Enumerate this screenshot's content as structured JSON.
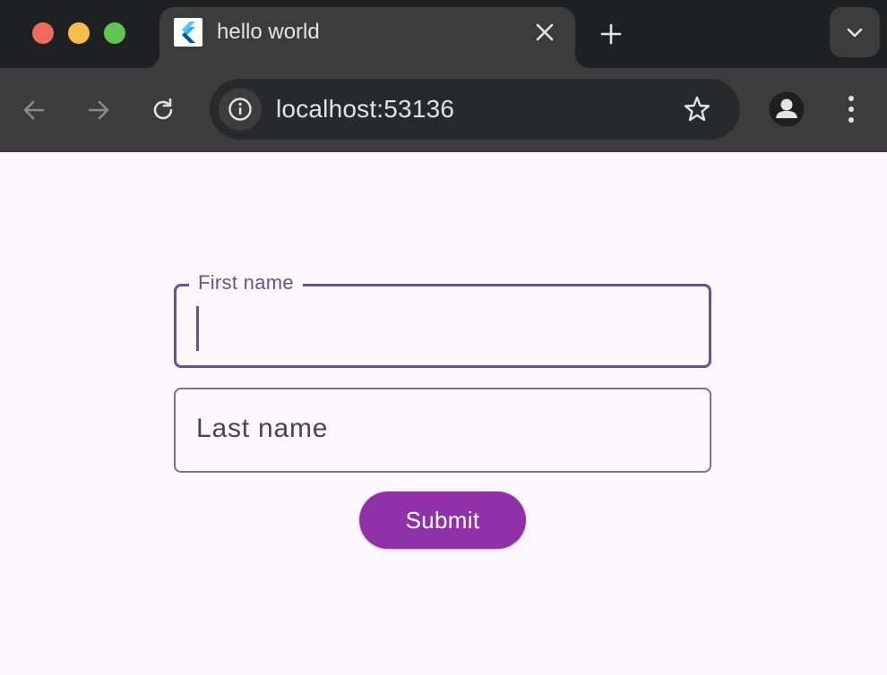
{
  "window": {
    "traffic_lights": [
      "close",
      "minimize",
      "maximize"
    ]
  },
  "tab": {
    "title": "hello world",
    "favicon": "flutter-logo-icon"
  },
  "toolbar": {
    "url": "localhost:53136"
  },
  "form": {
    "first_name_label": "First name",
    "first_name_value": "",
    "last_name_label": "Last name",
    "last_name_value": "",
    "submit_label": "Submit"
  },
  "colors": {
    "focused_outline": "#65558f",
    "outline": "#79747e",
    "submit_button": "#9131aa",
    "page_background": "#fcf6fd"
  }
}
